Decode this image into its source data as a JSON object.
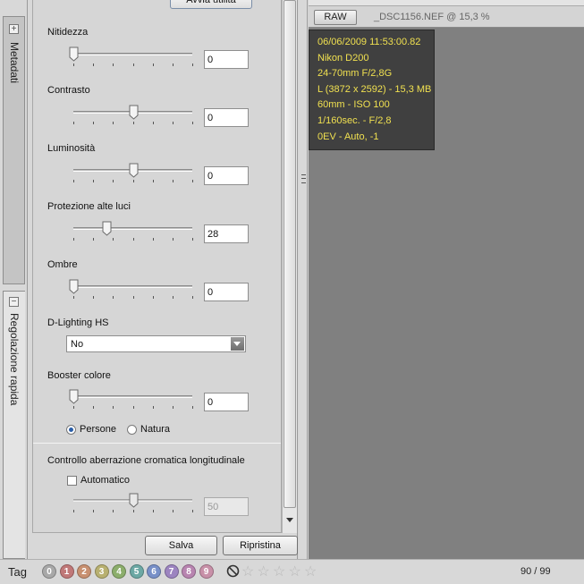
{
  "sidebar_tabs": [
    {
      "label": "Metadati",
      "toggle": "+"
    },
    {
      "label": "Regolazione rapida",
      "toggle": "−"
    }
  ],
  "panel": {
    "top_button_label": "Avvia utilità",
    "sliders": [
      {
        "label": "Nitidezza",
        "value": "0",
        "level": 0.0
      },
      {
        "label": "Contrasto",
        "value": "0",
        "level": 0.5
      },
      {
        "label": "Luminosità",
        "value": "0",
        "level": 0.5
      },
      {
        "label": "Protezione alte luci",
        "value": "28",
        "level": 0.28
      },
      {
        "label": "Ombre",
        "value": "0",
        "level": 0.0
      }
    ],
    "dlighting": {
      "label": "D-Lighting HS",
      "selected": "No"
    },
    "booster": {
      "label": "Booster colore",
      "value": "0",
      "level": 0.0,
      "radio_options": [
        {
          "label": "Persone",
          "checked": true
        },
        {
          "label": "Natura",
          "checked": false
        }
      ]
    },
    "aberration": {
      "label": "Controllo aberrazione cromatica longitudinale",
      "checkbox_label": "Automatico",
      "checked": false,
      "value": "50",
      "level": 0.5
    },
    "save_label": "Salva",
    "reset_label": "Ripristina"
  },
  "viewer": {
    "raw_label": "RAW",
    "filename": "_DSC1156.NEF @ 15,3 %",
    "info_lines": [
      "06/06/2009 11:53:00.82",
      "Nikon D200",
      "24-70mm F/2,8G",
      "L (3872 x 2592) - 15,3 MB",
      "60mm - ISO 100",
      "1/160sec. - F/2,8",
      "0EV - Auto, -1"
    ]
  },
  "bottom": {
    "tag_label": "Tag",
    "tags": [
      {
        "label": "0",
        "color": "#a8a8a8"
      },
      {
        "label": "1",
        "color": "#c07878"
      },
      {
        "label": "2",
        "color": "#c89070"
      },
      {
        "label": "3",
        "color": "#b8b070"
      },
      {
        "label": "4",
        "color": "#8cae6c"
      },
      {
        "label": "5",
        "color": "#6ca8a4"
      },
      {
        "label": "6",
        "color": "#7890c8"
      },
      {
        "label": "7",
        "color": "#9c84c0"
      },
      {
        "label": "8",
        "color": "#b884b0"
      },
      {
        "label": "9",
        "color": "#c890a8"
      }
    ],
    "rating_stars": 5,
    "counter": "90 / 99"
  }
}
